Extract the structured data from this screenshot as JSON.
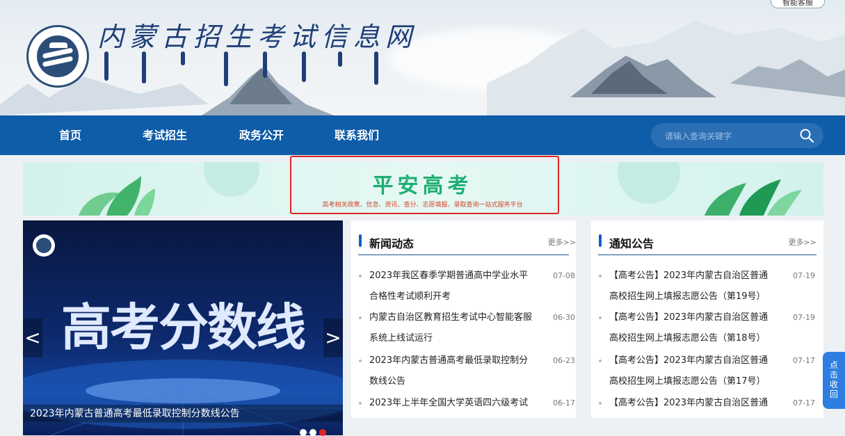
{
  "header": {
    "site_title": "内蒙古招生考试信息网",
    "lang_switch": "智能客服"
  },
  "nav": {
    "items": [
      "首页",
      "考试招生",
      "政务公开",
      "联系我们"
    ],
    "search_placeholder": "请输入查询关键字"
  },
  "banner": {
    "title": "平安高考",
    "subtitle": "高考相关政策、信息、资讯、查分、志愿填报、录取查询一站式服务平台"
  },
  "slider": {
    "headline": "高考分数线",
    "caption": "2023年内蒙古普通高考最低录取控制分数线公告",
    "prev": "<",
    "next": ">",
    "active_dot": 2
  },
  "news": {
    "title": "新闻动态",
    "more": "更多>>",
    "items": [
      {
        "line1": "2023年我区春季学期普通高中学业水平",
        "line2": "合格性考试顺利开考",
        "date": "07-08"
      },
      {
        "line1": "内蒙古自治区教育招生考试中心智能客服",
        "line2": "系统上线试运行",
        "date": "06-30"
      },
      {
        "line1": "2023年内蒙古普通高考最低录取控制分",
        "line2": "数线公告",
        "date": "06-23"
      },
      {
        "line1": "2023年上半年全国大学英语四六级考试",
        "line2": "",
        "date": "06-17"
      }
    ]
  },
  "notice": {
    "title": "通知公告",
    "more": "更多>>",
    "items": [
      {
        "line1": "【高考公告】2023年内蒙古自治区普通",
        "line2": "高校招生网上填报志愿公告（第19号）",
        "date": "07-19"
      },
      {
        "line1": "【高考公告】2023年内蒙古自治区普通",
        "line2": "高校招生网上填报志愿公告（第18号）",
        "date": "07-19"
      },
      {
        "line1": "【高考公告】2023年内蒙古自治区普通",
        "line2": "高校招生网上填报志愿公告（第17号）",
        "date": "07-17"
      },
      {
        "line1": "【高考公告】2023年内蒙古自治区普通",
        "line2": "",
        "date": "07-17"
      }
    ]
  },
  "side_tab": {
    "chars": [
      "点",
      "击",
      "收",
      "回"
    ]
  },
  "colors": {
    "nav_bg": "#0f5ca8",
    "accent_red": "#e02424",
    "banner_green": "#1fae73"
  }
}
